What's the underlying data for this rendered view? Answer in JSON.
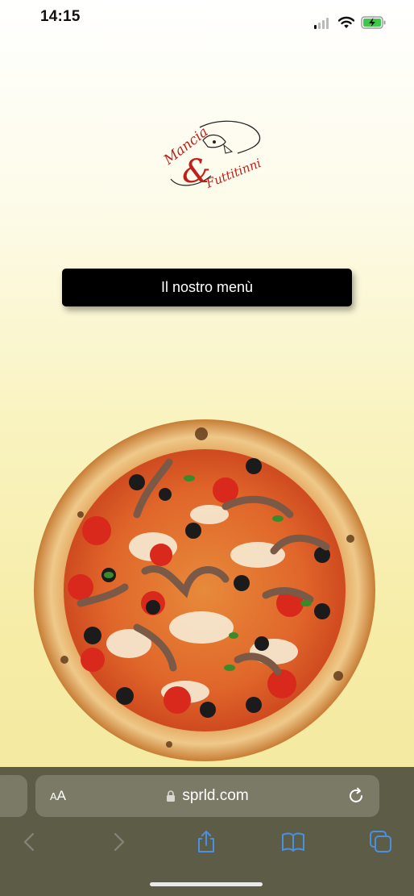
{
  "status_bar": {
    "time": "14:15"
  },
  "logo": {
    "line1": "Mancia",
    "ampersand": "&",
    "line2": "Futtitinni"
  },
  "main": {
    "menu_button_label": "Il nostro menù"
  },
  "safari": {
    "text_size_label_small": "A",
    "text_size_label_large": "A",
    "url": "sprld.com"
  },
  "icons": {
    "signal": "cellular-signal-icon",
    "wifi": "wifi-icon",
    "battery": "battery-charging-icon",
    "lock": "lock-icon",
    "reload": "reload-icon",
    "back": "back-icon",
    "forward": "forward-icon",
    "share": "share-icon",
    "bookmarks": "bookmarks-icon",
    "tabs": "tabs-icon"
  },
  "colors": {
    "accent": "#4a90e2",
    "logo_red": "#c0201c",
    "background": "#f6eca6"
  }
}
